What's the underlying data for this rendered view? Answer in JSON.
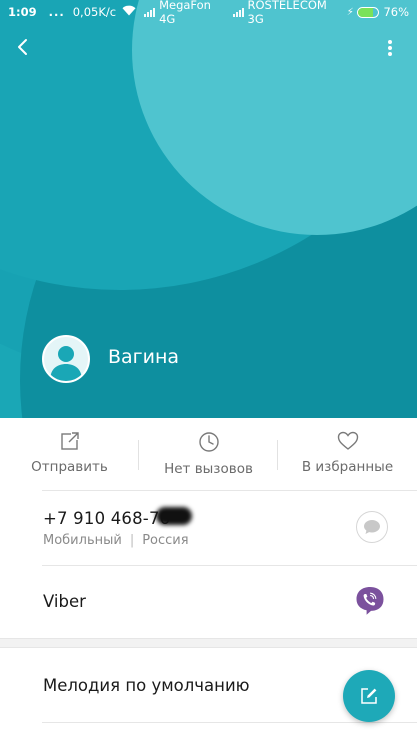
{
  "status_bar": {
    "time": "1:09",
    "dots": "...",
    "speed": "0,05K/c",
    "carrier1": "MegaFon 4G",
    "carrier2": "ROSTELECOM 3G",
    "battery_percent": "76%",
    "battery_level": 0.76
  },
  "icons": {
    "back": "chevron-left-icon",
    "more": "kebab-menu-icon",
    "send": "share-icon",
    "calls": "clock-icon",
    "favorites": "heart-icon",
    "sms": "chat-bubble-icon",
    "viber": "viber-icon",
    "edit": "edit-icon"
  },
  "contact": {
    "name": "Вагина"
  },
  "actions": [
    {
      "label": "Отправить"
    },
    {
      "label": "Нет вызовов"
    },
    {
      "label": "В избранные"
    }
  ],
  "phone": {
    "number": "+7 910 468-76-",
    "type": "Мобильный",
    "separator": "|",
    "region": "Россия"
  },
  "viber": {
    "label": "Viber"
  },
  "ringtone": {
    "label": "Мелодия по умолчанию"
  },
  "colors": {
    "header": "#1aa7b6",
    "header_light": "#4fc4cf",
    "header_dark": "#0e8f9f",
    "viber": "#7b519d",
    "fab": "#1ea9b8",
    "battery": "#7be25a"
  }
}
